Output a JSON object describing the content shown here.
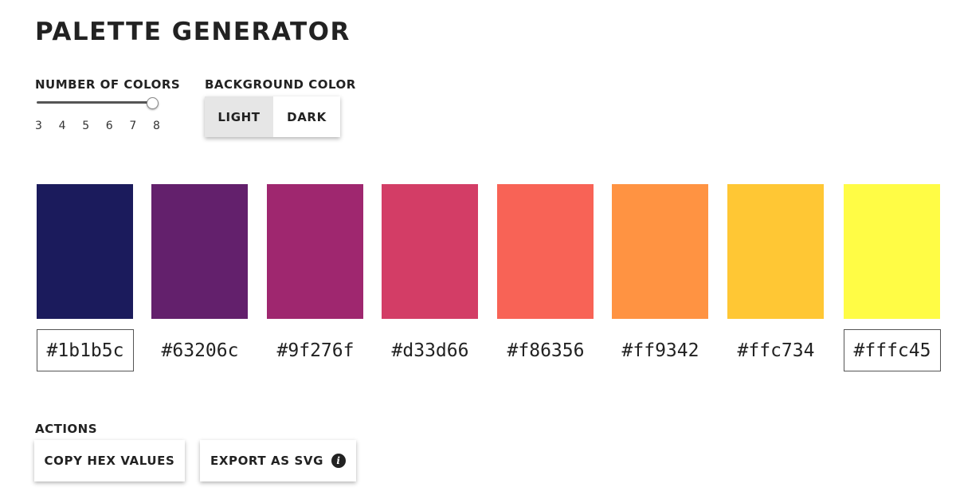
{
  "title": "PALETTE GENERATOR",
  "number_of_colors": {
    "label": "NUMBER OF COLORS",
    "ticks": [
      "3",
      "4",
      "5",
      "6",
      "7",
      "8"
    ],
    "min": 3,
    "max": 8,
    "value": 8
  },
  "background_color": {
    "label": "BACKGROUND COLOR",
    "options": [
      "LIGHT",
      "DARK"
    ],
    "selected": "LIGHT"
  },
  "palette": [
    {
      "hex": "#1b1b5c",
      "selected": true
    },
    {
      "hex": "#63206c",
      "selected": false
    },
    {
      "hex": "#9f276f",
      "selected": false
    },
    {
      "hex": "#d33d66",
      "selected": false
    },
    {
      "hex": "#f86356",
      "selected": false
    },
    {
      "hex": "#ff9342",
      "selected": false
    },
    {
      "hex": "#ffc734",
      "selected": false
    },
    {
      "hex": "#fffc45",
      "selected": true
    }
  ],
  "actions": {
    "label": "ACTIONS",
    "copy_label": "COPY HEX VALUES",
    "export_label": "EXPORT AS SVG",
    "export_icon": "info-icon"
  }
}
